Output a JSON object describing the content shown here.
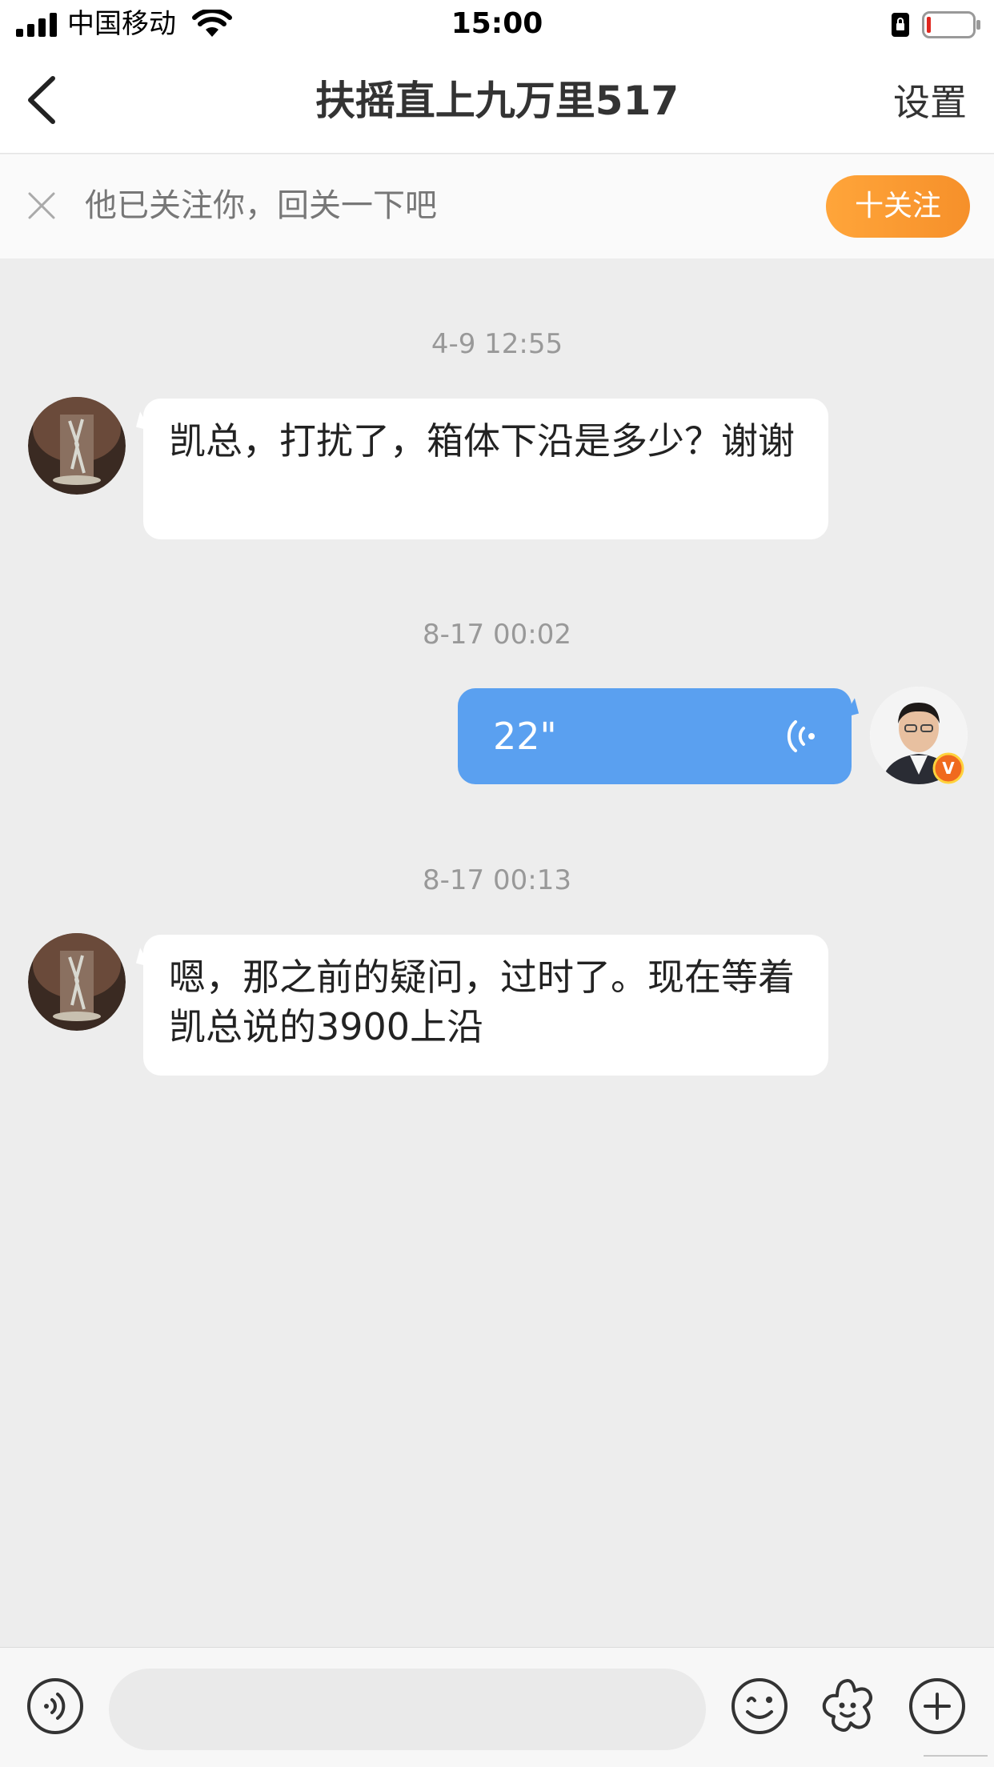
{
  "status_bar": {
    "carrier": "中国移动",
    "time": "15:00"
  },
  "nav": {
    "title": "扶摇直上九万里517",
    "settings_label": "设置",
    "back_icon": "chevron-left-icon"
  },
  "follow_banner": {
    "text": "他已关注你，回关一下吧",
    "button_label": "十关注",
    "accent_color": "#f6972e"
  },
  "messages": [
    {
      "timestamp": "4-9 12:55",
      "direction": "incoming",
      "type": "text",
      "text": "凯总，打扰了，箱体下沿是多少？谢谢"
    },
    {
      "timestamp": "8-17 00:02",
      "direction": "outgoing",
      "type": "voice",
      "duration": "22\"",
      "verified_badge": "V"
    },
    {
      "timestamp": "8-17 00:13",
      "direction": "incoming",
      "type": "text",
      "text": "嗯，那之前的疑问，过时了。现在等着凯总说的3900上沿"
    }
  ],
  "colors": {
    "chat_background": "#ededed",
    "outgoing_bubble": "#5aa0f0",
    "incoming_bubble": "#ffffff",
    "badge": "#f06a1e"
  },
  "toolbar": {
    "voice_icon": "voice-input-icon",
    "input_placeholder": "",
    "emoji_icon": "emoji-icon",
    "sticker_icon": "sticker-icon",
    "more_icon": "plus-icon"
  }
}
